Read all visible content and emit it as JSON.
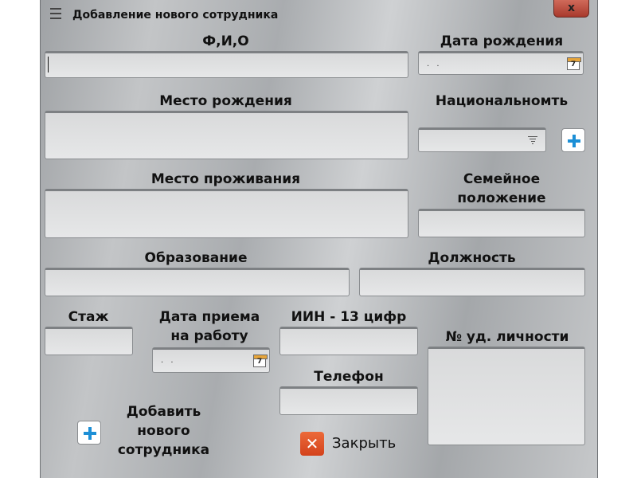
{
  "window": {
    "title": "Добавление нового сотрудника",
    "close_label": "x"
  },
  "labels": {
    "fio": "Ф,И,О",
    "birth_date": "Дата рождения",
    "birth_place": "Место рождения",
    "nationality": "Национальномть",
    "residence": "Место проживания",
    "marital_status_line1": "Семейное",
    "marital_status_line2": "положение",
    "education": "Образование",
    "position": "Должность",
    "experience": "Стаж",
    "hire_date_line1": "Дата приема",
    "hire_date_line2": "на работу",
    "iin": "ИИН - 13 цифр",
    "id_number": "№ уд. личности",
    "phone": "Телефон",
    "add_employee_line1": "Добавить",
    "add_employee_line2": "нового",
    "add_employee_line3": "сотрудника"
  },
  "fields": {
    "birth_date_value": ". .",
    "hire_date_value": ". .",
    "calendar_day": "7"
  },
  "buttons": {
    "close_label": "Закрыть"
  },
  "icons": {
    "menu": "menu-icon",
    "calendar": "calendar-icon",
    "plus": "plus-icon",
    "close": "close-icon"
  },
  "colors": {
    "accent_blue": "#1c8fd6",
    "close_orange": "#d3421b",
    "calendar_orange": "#e6a43a"
  }
}
